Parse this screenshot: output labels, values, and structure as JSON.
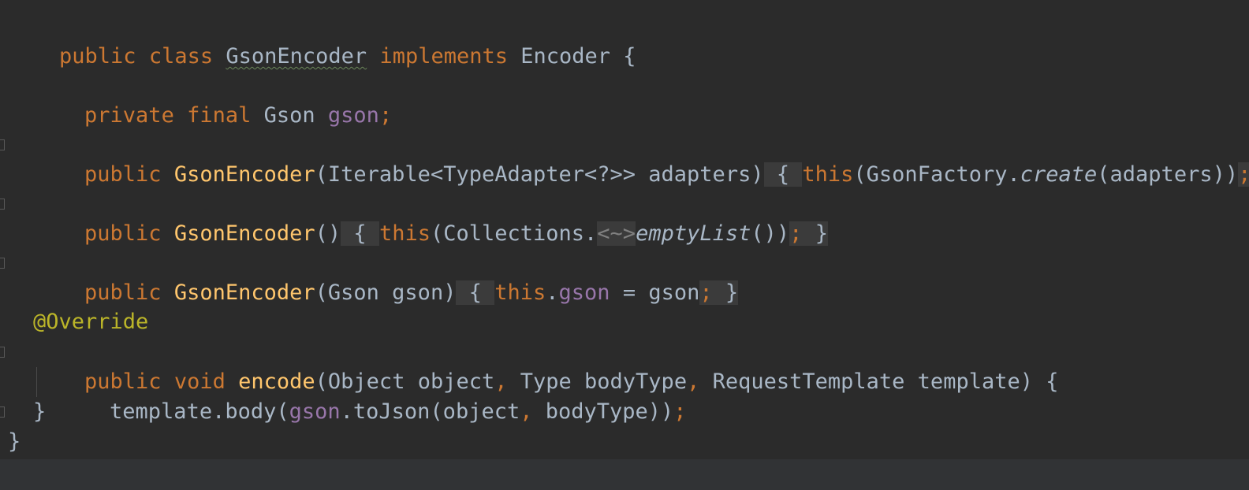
{
  "editor": {
    "lines": {
      "class_decl": {
        "public": "public ",
        "class": "class ",
        "name": "GsonEncoder",
        "implements": " implements ",
        "iface": "Encoder {"
      },
      "field": {
        "private": "private ",
        "final": "final ",
        "type": "Gson ",
        "name": "gson",
        "semi": ";"
      },
      "ctor1": {
        "public": "public ",
        "name": "GsonEncoder",
        "params": "(Iterable<TypeAdapter<?>> adapters)",
        "space": " ",
        "open": "{ ",
        "this": "this",
        "call1": "(GsonFactory.",
        "method": "create",
        "call2": "(adapters))",
        "semi": ";",
        "close": " }"
      },
      "ctor2": {
        "public": "public ",
        "name": "GsonEncoder",
        "params": "()",
        "space": " ",
        "open": "{ ",
        "this": "this",
        "call1": "(Collections.",
        "hint": "<~>",
        "method": "emptyList",
        "call2": "())",
        "semi": ";",
        "close": " }"
      },
      "ctor3": {
        "public": "public ",
        "name": "GsonEncoder",
        "params": "(Gson gson)",
        "space": " ",
        "open": "{ ",
        "this": "this",
        "dot": ".",
        "field": "gson",
        "assign": " = gson",
        "semi": ";",
        "close": " }"
      },
      "annotation": "@Override",
      "method_decl": {
        "public": "public ",
        "void": "void ",
        "name": "encode",
        "p1": "(Object object",
        "c1": ", ",
        "p2": "Type bodyType",
        "c2": ", ",
        "p3": "RequestTemplate template) {"
      },
      "body": {
        "prefix": "template.body(",
        "field": "gson",
        "call": ".toJson(object",
        "comma": ", ",
        "rest": "bodyType))",
        "semi": ";"
      },
      "method_close": "}",
      "class_close": "}"
    }
  },
  "colors": {
    "background": "#2b2b2b",
    "keyword": "#cc7832",
    "default": "#a9b7c6",
    "function": "#ffc66d",
    "field": "#9876aa",
    "annotation": "#bbb529"
  }
}
